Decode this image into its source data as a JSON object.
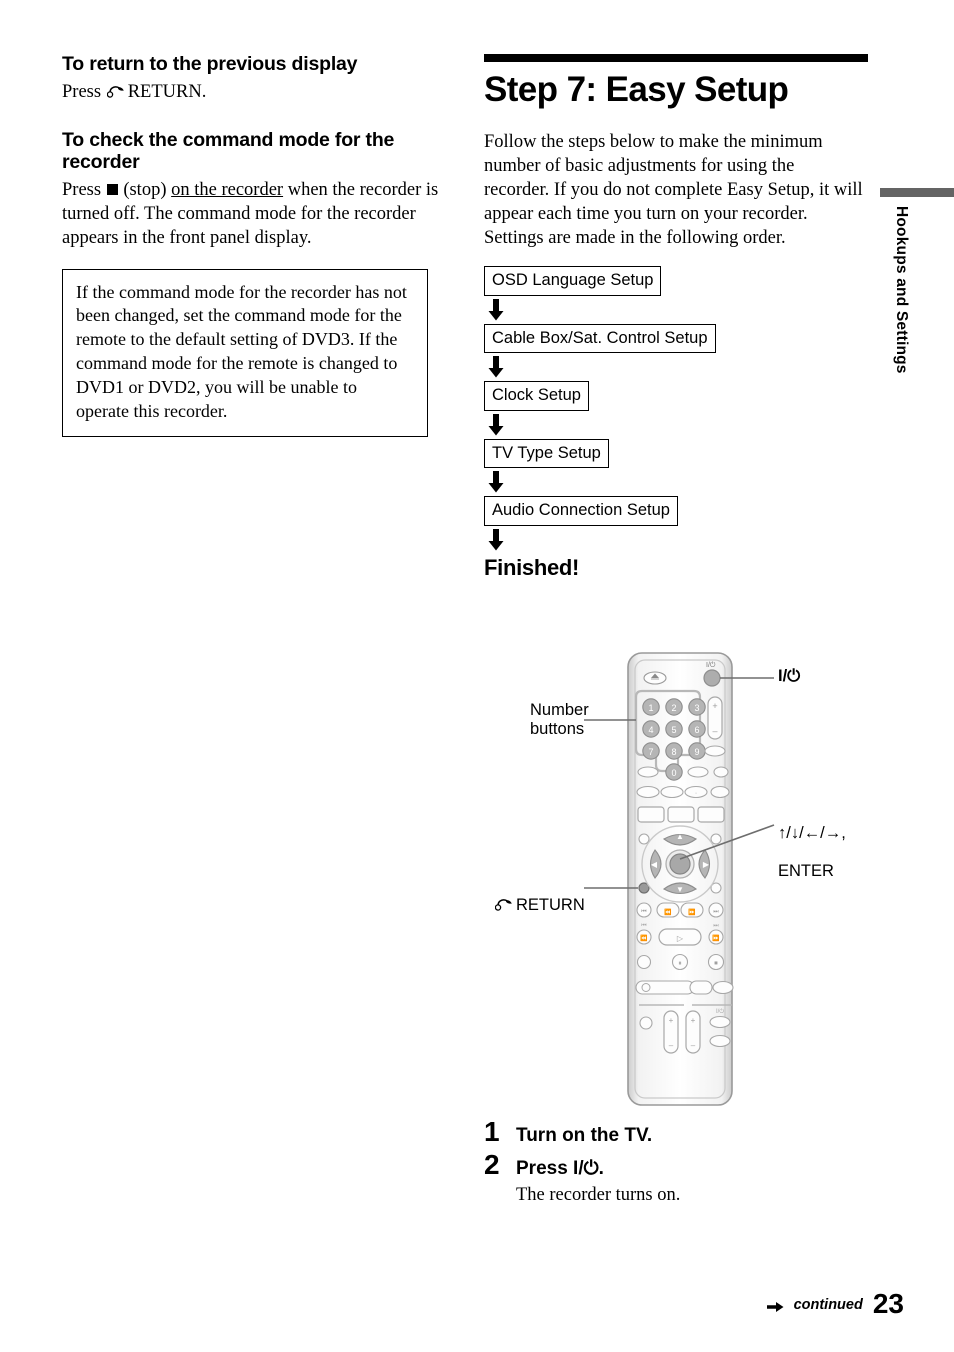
{
  "left_column": {
    "return_section": {
      "heading": "To return to the previous display",
      "press_word": "Press",
      "return_icon": "return-arrow-icon",
      "body_rest": "RETURN."
    },
    "command_mode_section": {
      "heading": "To check the command mode for the recorder",
      "press_word": "Press",
      "stop_icon": "stop-square-icon",
      "stop_label": "(stop)",
      "underlined_phrase": "on the recorder",
      "body_rest": "when the recorder is turned off. The command mode for the recorder appears in the front panel display."
    },
    "note_box": {
      "text": "If the command mode for the recorder has not been changed, set the command mode for the remote to the default setting of DVD3. If the command mode for the remote is changed to DVD1 or DVD2, you will be unable to operate this recorder."
    }
  },
  "right_column": {
    "step_title": "Step 7: Easy Setup",
    "intro": "Follow the steps below to make the minimum number of basic adjustments for using the recorder. If you do not complete Easy Setup, it will appear each time you turn on your recorder. Settings are made in the following order.",
    "flow": {
      "boxes": [
        "OSD Language Setup",
        "Cable Box/Sat. Control Setup",
        "Clock Setup",
        "TV Type Setup",
        "Audio Connection Setup"
      ],
      "arrow_icon": "down-arrow-icon",
      "finished": "Finished!"
    },
    "remote": {
      "callouts": {
        "number_buttons": "Number\nbuttons",
        "power": "I/⏻",
        "dpad_line1": "↑/↓/←/→,",
        "dpad_line2": "ENTER",
        "return_label": "RETURN",
        "return_icon": "return-arrow-icon"
      },
      "keypad_digits": [
        "1",
        "2",
        "3",
        "4",
        "5",
        "6",
        "7",
        "8",
        "9",
        "0"
      ],
      "power_glyph_small": "I/⏻"
    },
    "steps": [
      {
        "number": "1",
        "title": "Turn on the TV.",
        "sub": ""
      },
      {
        "number": "2",
        "title_prefix": "Press ",
        "title_symbol": "I/⏻",
        "title_suffix": ".",
        "sub": "The recorder turns on."
      }
    ]
  },
  "side_tab": {
    "label": "Hookups and Settings",
    "bar_color": "#646464"
  },
  "footer": {
    "continued": "continued",
    "continued_arrow_icon": "right-arrow-icon",
    "page_number": "23"
  }
}
